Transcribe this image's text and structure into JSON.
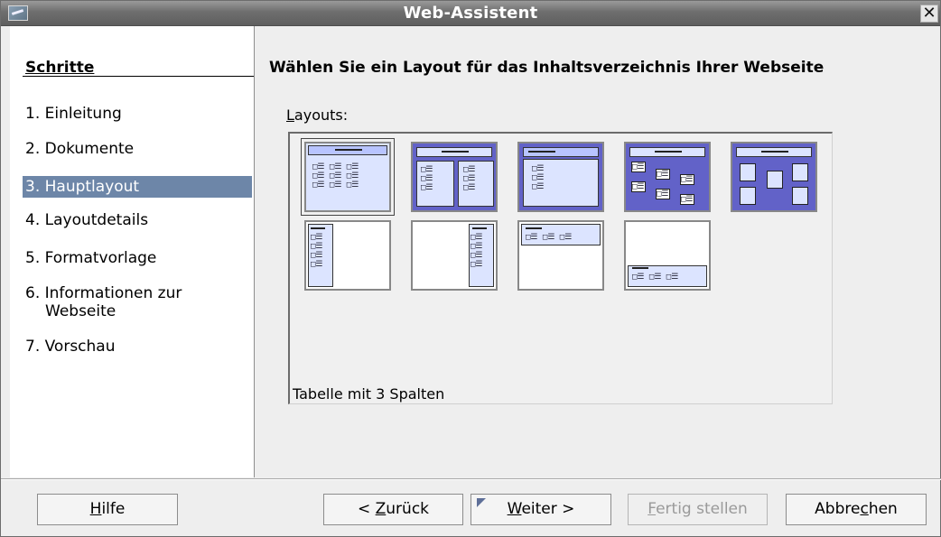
{
  "window": {
    "title": "Web-Assistent",
    "close_glyph": "✕"
  },
  "steps": {
    "heading": "Schritte",
    "items": [
      {
        "label": "1. Einleitung"
      },
      {
        "label": "2. Dokumente"
      },
      {
        "label": "3. Hauptlayout"
      },
      {
        "label": "4. Layoutdetails"
      },
      {
        "label": "5. Formatvorlage"
      },
      {
        "label": "6. Informationen zur",
        "label_cont": "Webseite"
      },
      {
        "label": "7. Vorschau"
      }
    ],
    "active_index": 2
  },
  "main": {
    "heading": "Wählen Sie ein Layout für das Inhaltsverzeichnis Ihrer Webseite",
    "layouts_label_prefix": "L",
    "layouts_label_rest": "ayouts:",
    "selected_caption": "Tabelle mit 3 Spalten"
  },
  "buttons": {
    "help": {
      "prefix": "",
      "mnemonic": "H",
      "rest": "ilfe"
    },
    "back": {
      "prefix": "< ",
      "mnemonic": "Z",
      "rest": "urück"
    },
    "next": {
      "prefix": "",
      "mnemonic": "W",
      "rest": "eiter >"
    },
    "finish": {
      "prefix": "",
      "mnemonic": "F",
      "rest": "ertig stellen"
    },
    "cancel": {
      "prefix": "Abbre",
      "mnemonic": "c",
      "rest": "hen"
    }
  },
  "colors": {
    "accent": "#6d86a8",
    "thumb_fill": "#6262c8",
    "thumb_light": "#dce4ff"
  }
}
